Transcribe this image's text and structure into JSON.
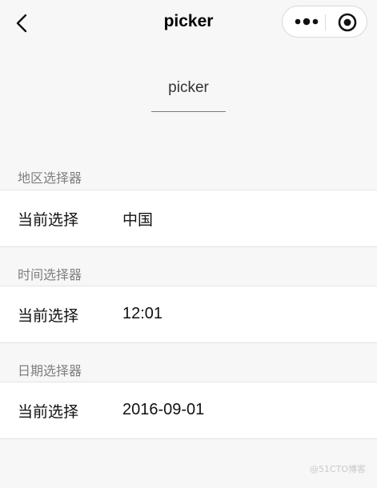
{
  "nav": {
    "title": "picker",
    "back_icon": "chevron-left-icon",
    "more_icon": "more-dots-icon",
    "close_icon": "target-circle-icon"
  },
  "intro": {
    "text": "picker"
  },
  "sections": [
    {
      "label": "地区选择器",
      "row_key": "当前选择",
      "row_value": "中国"
    },
    {
      "label": "时间选择器",
      "row_key": "当前选择",
      "row_value": "12:01"
    },
    {
      "label": "日期选择器",
      "row_key": "当前选择",
      "row_value": "2016-09-01"
    }
  ],
  "watermark": "@51CTO博客"
}
